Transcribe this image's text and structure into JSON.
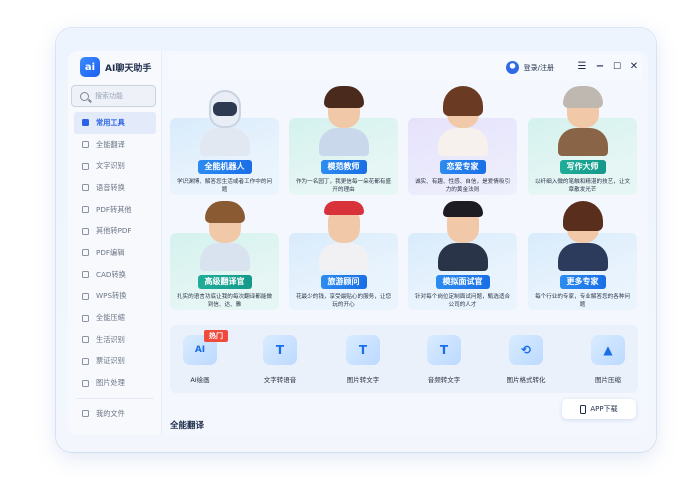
{
  "app": {
    "name": "AI聊天助手",
    "logo_text": "ai"
  },
  "search": {
    "placeholder": "搜索功能"
  },
  "header": {
    "login": "登录/注册"
  },
  "sidebar": {
    "items": [
      {
        "label": "常用工具",
        "active": true
      },
      {
        "label": "全能翻译"
      },
      {
        "label": "文字识别"
      },
      {
        "label": "语音转换"
      },
      {
        "label": "PDF转其他"
      },
      {
        "label": "其他转PDF"
      },
      {
        "label": "PDF编辑"
      },
      {
        "label": "CAD转换"
      },
      {
        "label": "WPS转换"
      },
      {
        "label": "全能压缩"
      },
      {
        "label": "生活识别"
      },
      {
        "label": "票证识别"
      },
      {
        "label": "图片处理"
      }
    ],
    "files": "我的文件"
  },
  "cards": [
    {
      "title": "全能机器人",
      "desc": "学识渊博、解答您生活或者工作中的问题"
    },
    {
      "title": "模范教师",
      "desc": "作为一名园丁，我更信每一朵花都有盛开的理由"
    },
    {
      "title": "恋爱专家",
      "desc": "诚实、有趣、性感、自信，是爱情吸引力的黄金法则"
    },
    {
      "title": "写作大师",
      "desc": "以纤细入微的笔触和精湛的技艺，让文章散发光芒"
    },
    {
      "title": "高级翻译官",
      "desc": "扎实的语言功底让我的每次翻译都能做到信、达、雅"
    },
    {
      "title": "旅游顾问",
      "desc": "花最少的钱，享受最贴心的服务，让您玩的开心"
    },
    {
      "title": "模拟面试官",
      "desc": "针对每个岗位定制面试问题，甄选适合公司的人才"
    },
    {
      "title": "更多专家",
      "desc": "每个行业的专家，专业解答您的各种问题"
    }
  ],
  "tools": {
    "hot_badge": "热门",
    "items": [
      {
        "label": "AI绘画",
        "icon": "ai-paint-icon",
        "glyph": "AI"
      },
      {
        "label": "文字转语音",
        "icon": "text-to-speech-icon",
        "glyph": "T"
      },
      {
        "label": "图片转文字",
        "icon": "image-to-text-icon",
        "glyph": "T"
      },
      {
        "label": "音频转文字",
        "icon": "audio-to-text-icon",
        "glyph": "T"
      },
      {
        "label": "图片格式转化",
        "icon": "image-convert-icon",
        "glyph": "⟲"
      },
      {
        "label": "图片压缩",
        "icon": "image-compress-icon",
        "glyph": "▲"
      }
    ]
  },
  "app_download": "APP下载",
  "section_title": "全能翻译",
  "colors": {
    "accent": "#2c62e8",
    "badge_blue": "#1a6ee6",
    "badge_teal": "#14988a",
    "hot": "#f04a3c"
  }
}
